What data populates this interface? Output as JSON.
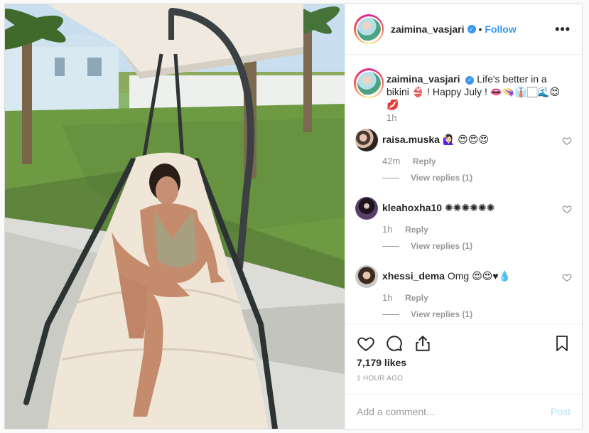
{
  "post": {
    "username": "zaimina_vasjari",
    "follow_label": "Follow",
    "separator": "•",
    "more_label": "•••",
    "verified_mark": "✓"
  },
  "caption": {
    "username": "zaimina_vasjari",
    "text": "Life's better in a bikini 👙 ! Happy July ! 👄👒👔🏻🌊😍💋",
    "time": "1h"
  },
  "comments": [
    {
      "username": "raisa.muska",
      "text": "🙋🏻‍♀️ 😍😍😍",
      "time": "42m",
      "reply": "Reply",
      "views": "View replies (1)"
    },
    {
      "username": "kleahoxha10",
      "text": "✺✺✺✺✺✺",
      "time": "1h",
      "reply": "Reply",
      "views": "View replies (1)"
    },
    {
      "username": "xhessi_dema",
      "text": "Omg 😍😍♥💧",
      "time": "1h",
      "reply": "Reply",
      "views": "View replies (1)"
    }
  ],
  "actions": {
    "likes": "7,179 likes",
    "ago": "1 HOUR AGO"
  },
  "add_comment": {
    "placeholder": "Add a comment...",
    "post_label": "Post"
  },
  "colors": {
    "link_blue": "#3897f0",
    "post_disabled": "#b2dffc",
    "meta_grey": "#8e8e8e"
  },
  "icons": [
    "verified-badge-icon",
    "more-options-icon",
    "heart-icon",
    "comment-icon",
    "share-icon",
    "bookmark-icon"
  ]
}
